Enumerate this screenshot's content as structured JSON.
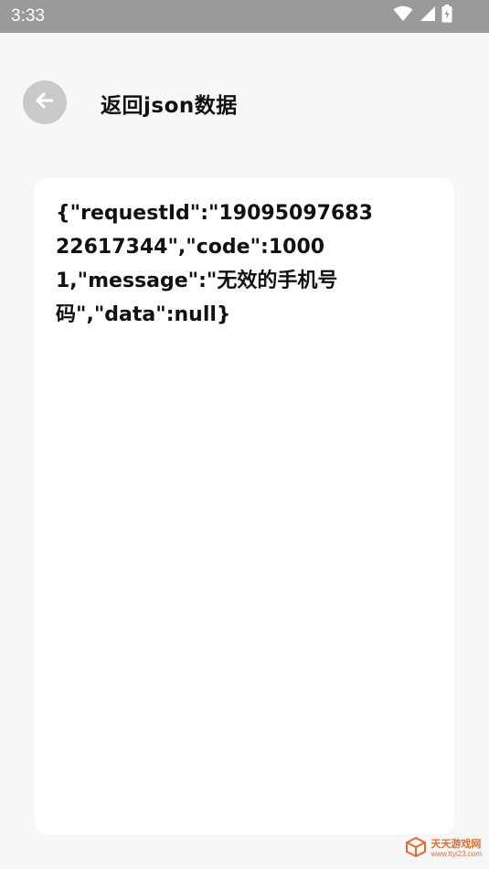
{
  "status_bar": {
    "time": "3:33",
    "icons": [
      "wifi-icon",
      "signal-icon",
      "battery-icon"
    ]
  },
  "header": {
    "back_icon": "arrow-left-icon",
    "title": "返回json数据"
  },
  "content": {
    "json_text": "{\"requestId\":\"1909509768322617344\",\"code\":10001,\"message\":\"无效的手机号码\",\"data\":null}"
  },
  "watermark": {
    "title": "天天游戏网",
    "url": "www.ttyl23.com"
  },
  "colors": {
    "status_bar_bg": "#9a9a9a",
    "page_bg": "#f6f7f9",
    "back_button_bg": "#c9c9cb",
    "card_bg": "#ffffff",
    "watermark": "#e76a2e"
  }
}
